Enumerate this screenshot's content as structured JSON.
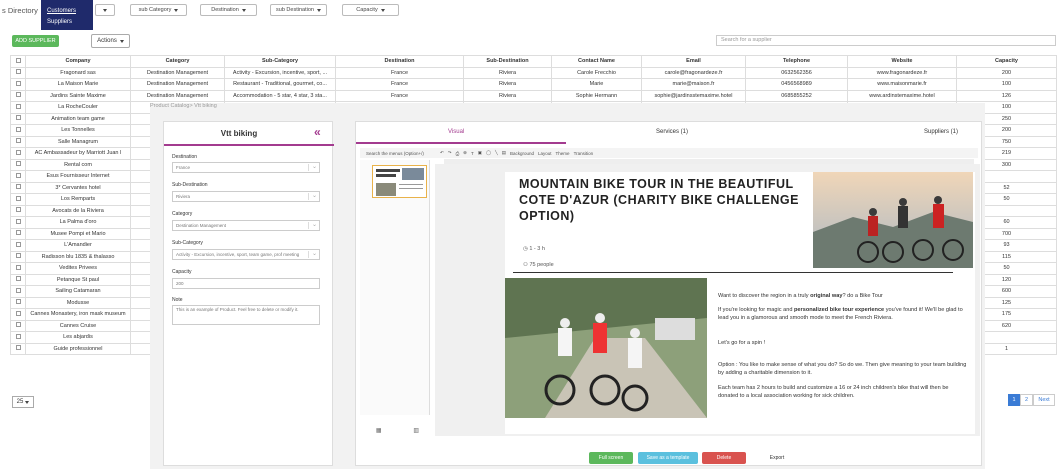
{
  "topbar": {
    "breadcrumb": "s Directory",
    "menu": [
      "Customers",
      "Suppliers"
    ],
    "filters": [
      "sub Category",
      "Destination",
      "sub Destination",
      "Capacity"
    ]
  },
  "toolbar": {
    "add_label": "ADD SUPPLIER",
    "actions_label": "Actions",
    "search_placeholder": "Search for a supplier"
  },
  "table": {
    "headers": [
      "Company",
      "Category",
      "Sub-Category",
      "Destination",
      "Sub-Destination",
      "Contact Name",
      "Email",
      "Telephone",
      "Website",
      "Capacity"
    ],
    "rows": [
      [
        "Fragonard sas",
        "Destination Management",
        "Activity - Excursion, incentive, sport, ...",
        "France",
        "Riviera",
        "Carole Frecchio",
        "carole@fragonardeze.fr",
        "0632562356",
        "www.fragonardeze.fr",
        "200"
      ],
      [
        "La Maison Marie",
        "Destination Management",
        "Restaurant - Traditional, gourmet, co...",
        "France",
        "Riviera",
        "Marie",
        "marie@maison.fr",
        "0456568989",
        "www.maisonmarie.fr",
        "100"
      ],
      [
        "Jardins Sainte Maxime",
        "Destination Management",
        "Accommodation - 5 star, 4 star, 3 sta...",
        "France",
        "Riviera",
        "Sophie Hermann",
        "sophie@jardinsstemaxime.hotel",
        "0685855252",
        "www.ardinstemaxime.hotel",
        "126"
      ],
      [
        "La RocheCouler",
        "Ve",
        "",
        "",
        "",
        "",
        "",
        "",
        "",
        "100"
      ],
      [
        "Animation team game",
        "Desti",
        "",
        "",
        "",
        "",
        "",
        "",
        "",
        "250"
      ],
      [
        "Les Tonnelles",
        "Desti",
        "",
        "",
        "",
        "",
        "",
        "",
        "",
        "200"
      ],
      [
        "Salle Managrum",
        "Desti",
        "",
        "",
        "",
        "",
        "",
        "",
        "",
        "750"
      ],
      [
        "AC Ambassadeur by Marriott Juan l",
        "Desti",
        "",
        "",
        "",
        "",
        "",
        "",
        "",
        "219"
      ],
      [
        "Rental com",
        "Desti",
        "",
        "",
        "",
        "",
        "",
        "",
        "",
        "300"
      ],
      [
        "Esus Fournisseur Internet",
        "Ve",
        "",
        "",
        "",
        "",
        "",
        "",
        "",
        ""
      ],
      [
        "3* Cervantes hotel",
        "Desti",
        "",
        "",
        "",
        "",
        "",
        "",
        "",
        "52"
      ],
      [
        "Los Remparts",
        "Desti",
        "",
        "",
        "",
        "",
        "",
        "",
        "",
        "50"
      ],
      [
        "Avocats de la Riviera",
        "Ve",
        "",
        "",
        "",
        "",
        "",
        "",
        "",
        ""
      ],
      [
        "La Palma d'oro",
        "Desti",
        "",
        "",
        "",
        "",
        "",
        "",
        "",
        "60"
      ],
      [
        "Musee Pompi et Mario",
        "Desti",
        "",
        "",
        "",
        "",
        "",
        "",
        "",
        "700"
      ],
      [
        "L'Amandier",
        "Desti",
        "",
        "",
        "",
        "",
        "",
        "",
        "",
        "93"
      ],
      [
        "Radisson blu 1835 & thalasso",
        "Desti",
        "",
        "",
        "",
        "",
        "",
        "",
        "",
        "115"
      ],
      [
        "Vedites Privees",
        "Desti",
        "",
        "",
        "",
        "",
        "",
        "",
        "",
        "50"
      ],
      [
        "Petanque St paul",
        "Desti",
        "",
        "",
        "",
        "",
        "",
        "",
        "",
        "120"
      ],
      [
        "Sailing Catamaran",
        "Desti",
        "",
        "",
        "",
        "",
        "",
        "",
        "",
        "600"
      ],
      [
        "Modusse",
        "Desti",
        "",
        "",
        "",
        "",
        "",
        "",
        "",
        "125"
      ],
      [
        "Cannes Monastery, iron mask museum",
        "Desti",
        "",
        "",
        "",
        "",
        "",
        "",
        "",
        "175"
      ],
      [
        "Cannes Cruise",
        "Desti",
        "",
        "",
        "",
        "",
        "",
        "",
        "",
        "620"
      ],
      [
        "Les abjardis",
        "Ve",
        "",
        "",
        "",
        "",
        "",
        "",
        "",
        ""
      ],
      [
        "Guide professionnel",
        "Desti",
        "",
        "",
        "",
        "",
        "",
        "",
        "",
        "1"
      ]
    ]
  },
  "pagination": {
    "page_size": "25",
    "pages": [
      "1",
      "2"
    ],
    "next": "Next"
  },
  "overlay": {
    "title": "Product Catalog> Vtt biking",
    "form": {
      "heading": "Vtt biking",
      "fields": [
        {
          "label": "Destination",
          "value": "France"
        },
        {
          "label": "Sub-Destination",
          "value": "Riviera"
        },
        {
          "label": "Category",
          "value": "Destination Management"
        },
        {
          "label": "Sub-Category",
          "value": "Activity - Excursion, incentive, sport, team game, prof meeting"
        },
        {
          "label": "Capacity",
          "value": "200"
        },
        {
          "label": "Note",
          "value": "This is an example of Product. Feel free to delete or modify it."
        }
      ]
    },
    "tabs": [
      "Visual",
      "Services (1)",
      "Suppliers (1)"
    ],
    "editor_toolbar": "Search the menus (Option+/)",
    "editor_menu": [
      "Background",
      "Layout",
      "Theme",
      "Transition"
    ],
    "slide": {
      "title": "MOUNTAIN BIKE TOUR IN THE BEAUTIFUL COTE D'AZUR (CHARITY BIKE CHALLENGE OPTION)",
      "duration": "1 - 3 h",
      "people": "75 people",
      "p1_a": "Want to discover the region in a truly ",
      "p1_b": "original way",
      "p1_c": "? do a Bike Tour",
      "p2_a": "If you're looking for magic and ",
      "p2_b": "personalized bike tour experience",
      "p2_c": " you've found it! We'll be glad to lead you in a glamorous and smooth mode to meet the French Riviera.",
      "p3": "Let's go for a spin !",
      "p4": "Option : You like to make sense of what you do? So do we. Then give meaning to your team building by adding a charitable dimension to it.",
      "p5": "Each team has 2 hours to build and customize a 16 or 24 inch children's bike that will then be donated to a local association working for sick children."
    },
    "buttons": {
      "fullscreen": "Full screen",
      "template": "Save as a template",
      "delete": "Delete",
      "export": "Export"
    }
  }
}
